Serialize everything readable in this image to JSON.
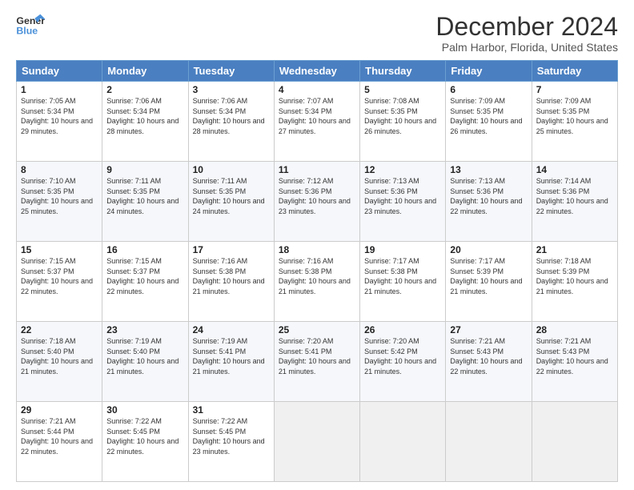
{
  "header": {
    "logo_general": "General",
    "logo_blue": "Blue",
    "title": "December 2024",
    "location": "Palm Harbor, Florida, United States"
  },
  "weekdays": [
    "Sunday",
    "Monday",
    "Tuesday",
    "Wednesday",
    "Thursday",
    "Friday",
    "Saturday"
  ],
  "weeks": [
    [
      {
        "day": "1",
        "sunrise": "Sunrise: 7:05 AM",
        "sunset": "Sunset: 5:34 PM",
        "daylight": "Daylight: 10 hours and 29 minutes."
      },
      {
        "day": "2",
        "sunrise": "Sunrise: 7:06 AM",
        "sunset": "Sunset: 5:34 PM",
        "daylight": "Daylight: 10 hours and 28 minutes."
      },
      {
        "day": "3",
        "sunrise": "Sunrise: 7:06 AM",
        "sunset": "Sunset: 5:34 PM",
        "daylight": "Daylight: 10 hours and 28 minutes."
      },
      {
        "day": "4",
        "sunrise": "Sunrise: 7:07 AM",
        "sunset": "Sunset: 5:34 PM",
        "daylight": "Daylight: 10 hours and 27 minutes."
      },
      {
        "day": "5",
        "sunrise": "Sunrise: 7:08 AM",
        "sunset": "Sunset: 5:35 PM",
        "daylight": "Daylight: 10 hours and 26 minutes."
      },
      {
        "day": "6",
        "sunrise": "Sunrise: 7:09 AM",
        "sunset": "Sunset: 5:35 PM",
        "daylight": "Daylight: 10 hours and 26 minutes."
      },
      {
        "day": "7",
        "sunrise": "Sunrise: 7:09 AM",
        "sunset": "Sunset: 5:35 PM",
        "daylight": "Daylight: 10 hours and 25 minutes."
      }
    ],
    [
      {
        "day": "8",
        "sunrise": "Sunrise: 7:10 AM",
        "sunset": "Sunset: 5:35 PM",
        "daylight": "Daylight: 10 hours and 25 minutes."
      },
      {
        "day": "9",
        "sunrise": "Sunrise: 7:11 AM",
        "sunset": "Sunset: 5:35 PM",
        "daylight": "Daylight: 10 hours and 24 minutes."
      },
      {
        "day": "10",
        "sunrise": "Sunrise: 7:11 AM",
        "sunset": "Sunset: 5:35 PM",
        "daylight": "Daylight: 10 hours and 24 minutes."
      },
      {
        "day": "11",
        "sunrise": "Sunrise: 7:12 AM",
        "sunset": "Sunset: 5:36 PM",
        "daylight": "Daylight: 10 hours and 23 minutes."
      },
      {
        "day": "12",
        "sunrise": "Sunrise: 7:13 AM",
        "sunset": "Sunset: 5:36 PM",
        "daylight": "Daylight: 10 hours and 23 minutes."
      },
      {
        "day": "13",
        "sunrise": "Sunrise: 7:13 AM",
        "sunset": "Sunset: 5:36 PM",
        "daylight": "Daylight: 10 hours and 22 minutes."
      },
      {
        "day": "14",
        "sunrise": "Sunrise: 7:14 AM",
        "sunset": "Sunset: 5:36 PM",
        "daylight": "Daylight: 10 hours and 22 minutes."
      }
    ],
    [
      {
        "day": "15",
        "sunrise": "Sunrise: 7:15 AM",
        "sunset": "Sunset: 5:37 PM",
        "daylight": "Daylight: 10 hours and 22 minutes."
      },
      {
        "day": "16",
        "sunrise": "Sunrise: 7:15 AM",
        "sunset": "Sunset: 5:37 PM",
        "daylight": "Daylight: 10 hours and 22 minutes."
      },
      {
        "day": "17",
        "sunrise": "Sunrise: 7:16 AM",
        "sunset": "Sunset: 5:38 PM",
        "daylight": "Daylight: 10 hours and 21 minutes."
      },
      {
        "day": "18",
        "sunrise": "Sunrise: 7:16 AM",
        "sunset": "Sunset: 5:38 PM",
        "daylight": "Daylight: 10 hours and 21 minutes."
      },
      {
        "day": "19",
        "sunrise": "Sunrise: 7:17 AM",
        "sunset": "Sunset: 5:38 PM",
        "daylight": "Daylight: 10 hours and 21 minutes."
      },
      {
        "day": "20",
        "sunrise": "Sunrise: 7:17 AM",
        "sunset": "Sunset: 5:39 PM",
        "daylight": "Daylight: 10 hours and 21 minutes."
      },
      {
        "day": "21",
        "sunrise": "Sunrise: 7:18 AM",
        "sunset": "Sunset: 5:39 PM",
        "daylight": "Daylight: 10 hours and 21 minutes."
      }
    ],
    [
      {
        "day": "22",
        "sunrise": "Sunrise: 7:18 AM",
        "sunset": "Sunset: 5:40 PM",
        "daylight": "Daylight: 10 hours and 21 minutes."
      },
      {
        "day": "23",
        "sunrise": "Sunrise: 7:19 AM",
        "sunset": "Sunset: 5:40 PM",
        "daylight": "Daylight: 10 hours and 21 minutes."
      },
      {
        "day": "24",
        "sunrise": "Sunrise: 7:19 AM",
        "sunset": "Sunset: 5:41 PM",
        "daylight": "Daylight: 10 hours and 21 minutes."
      },
      {
        "day": "25",
        "sunrise": "Sunrise: 7:20 AM",
        "sunset": "Sunset: 5:41 PM",
        "daylight": "Daylight: 10 hours and 21 minutes."
      },
      {
        "day": "26",
        "sunrise": "Sunrise: 7:20 AM",
        "sunset": "Sunset: 5:42 PM",
        "daylight": "Daylight: 10 hours and 21 minutes."
      },
      {
        "day": "27",
        "sunrise": "Sunrise: 7:21 AM",
        "sunset": "Sunset: 5:43 PM",
        "daylight": "Daylight: 10 hours and 22 minutes."
      },
      {
        "day": "28",
        "sunrise": "Sunrise: 7:21 AM",
        "sunset": "Sunset: 5:43 PM",
        "daylight": "Daylight: 10 hours and 22 minutes."
      }
    ],
    [
      {
        "day": "29",
        "sunrise": "Sunrise: 7:21 AM",
        "sunset": "Sunset: 5:44 PM",
        "daylight": "Daylight: 10 hours and 22 minutes."
      },
      {
        "day": "30",
        "sunrise": "Sunrise: 7:22 AM",
        "sunset": "Sunset: 5:45 PM",
        "daylight": "Daylight: 10 hours and 22 minutes."
      },
      {
        "day": "31",
        "sunrise": "Sunrise: 7:22 AM",
        "sunset": "Sunset: 5:45 PM",
        "daylight": "Daylight: 10 hours and 23 minutes."
      },
      null,
      null,
      null,
      null
    ]
  ]
}
